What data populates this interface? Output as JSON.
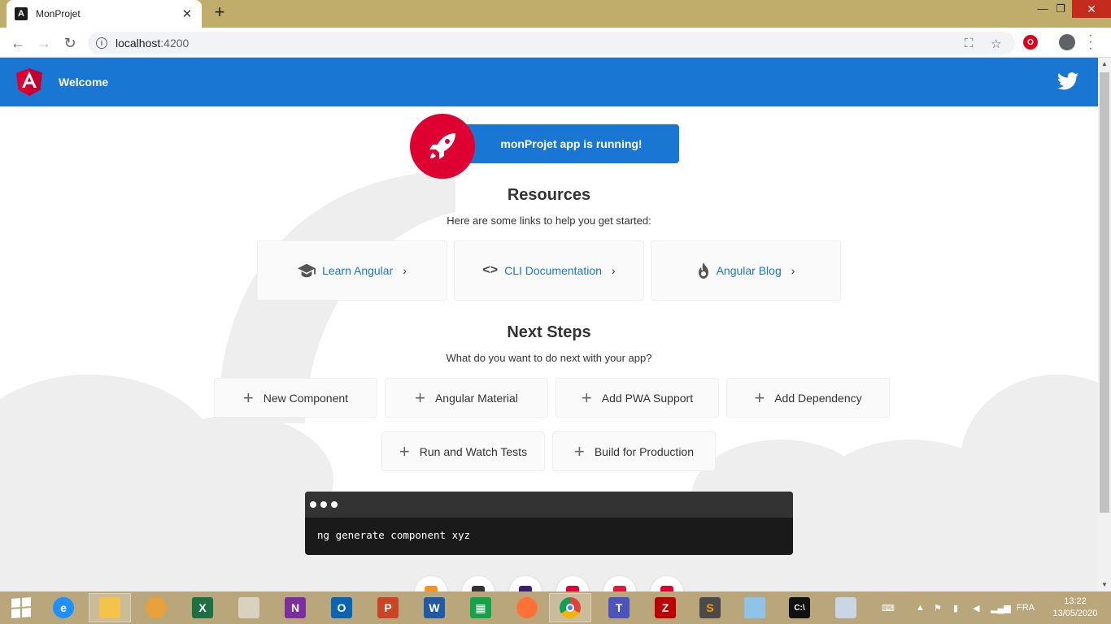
{
  "browser": {
    "tab_title": "MonProjet",
    "tab_close": "✕",
    "new_tab": "+",
    "url_host": "localhost",
    "url_port": ":4200",
    "win_minimize": "—",
    "win_maximize": "❐",
    "win_close": "✕"
  },
  "app": {
    "header_title": "Welcome",
    "running_banner": "monProjet app is running!",
    "resources_title": "Resources",
    "resources_subtitle": "Here are some links to help you get started:",
    "resources": [
      {
        "label": "Learn Angular",
        "icon": "graduation-cap-icon"
      },
      {
        "label": "CLI Documentation",
        "icon": "code-icon"
      },
      {
        "label": "Angular Blog",
        "icon": "flame-icon"
      }
    ],
    "next_steps_title": "Next Steps",
    "next_steps_subtitle": "What do you want to do next with your app?",
    "steps": [
      {
        "label": "New Component"
      },
      {
        "label": "Angular Material"
      },
      {
        "label": "Add PWA Support"
      },
      {
        "label": "Add Dependency"
      },
      {
        "label": "Run and Watch Tests"
      },
      {
        "label": "Build for Production"
      }
    ],
    "terminal_command": "ng generate component xyz",
    "colors": {
      "header_blue": "#1976d2",
      "angular_red": "#dd0031"
    }
  },
  "taskbar": {
    "language": "FRA",
    "time": "13:22",
    "date": "13/05/2020",
    "apps": [
      "internet-explorer",
      "file-explorer",
      "media-app",
      "excel",
      "notepad-app",
      "onenote",
      "outlook",
      "powerpoint",
      "word",
      "store",
      "firefox",
      "chrome",
      "teams",
      "filezilla",
      "sublime-text",
      "paint-app",
      "command-prompt",
      "snipping-tool"
    ]
  }
}
